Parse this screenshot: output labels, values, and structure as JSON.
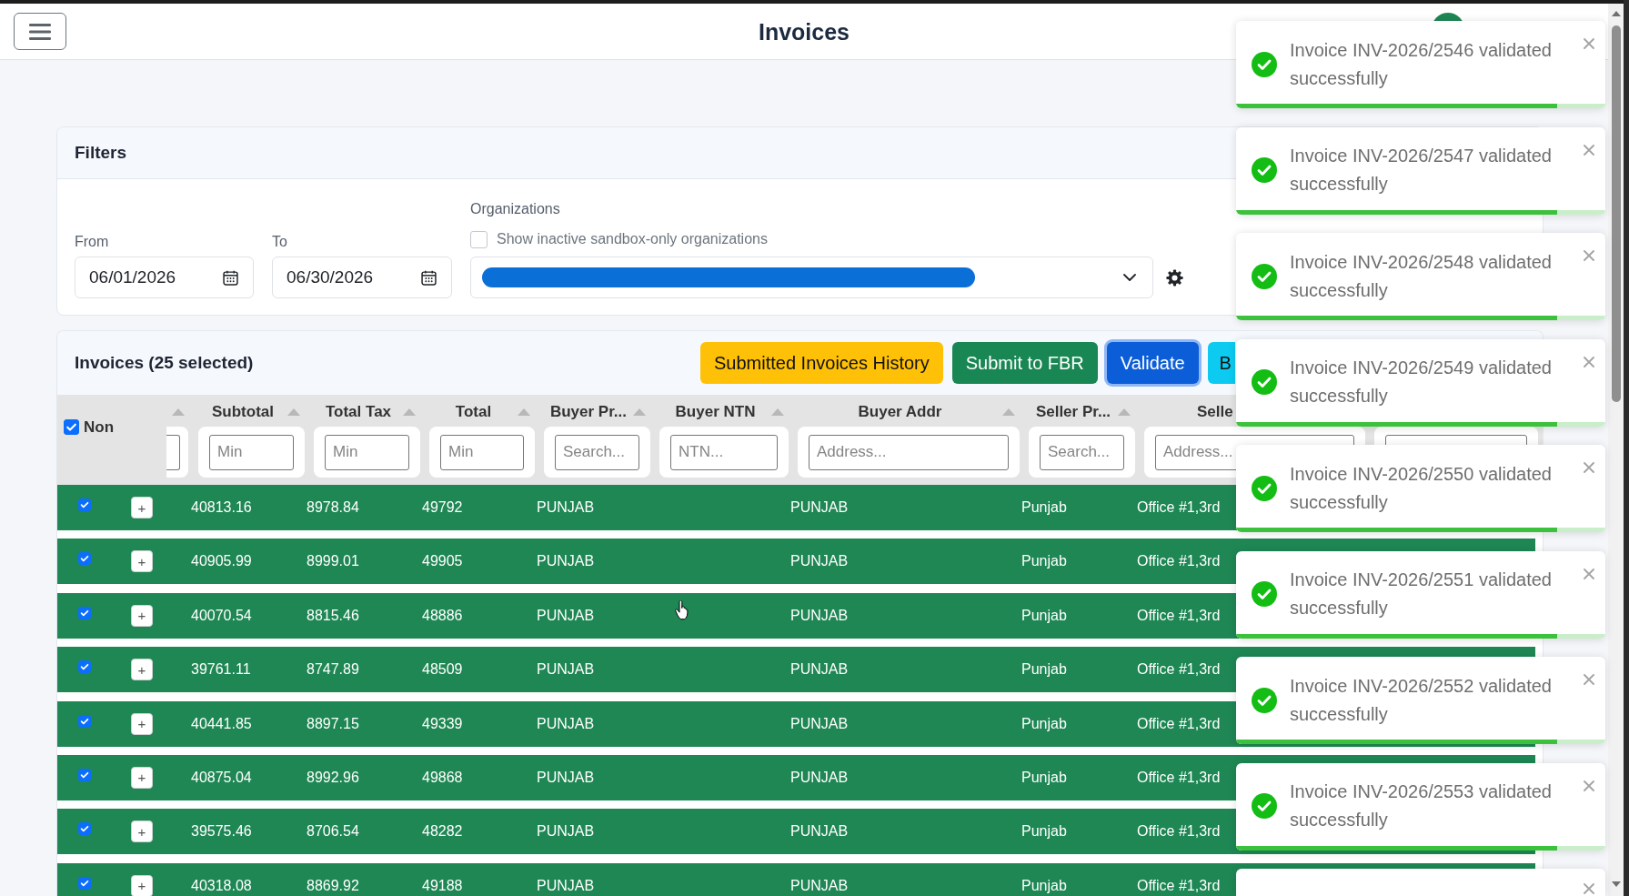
{
  "header": {
    "title": "Invoices"
  },
  "filters": {
    "title": "Filters",
    "from": {
      "label": "From",
      "value": "06/01/2026"
    },
    "to": {
      "label": "To",
      "value": "06/30/2026"
    },
    "organizations": {
      "label": "Organizations",
      "show_inactive": {
        "label": "Show inactive sandbox-only organizations",
        "checked": false
      },
      "select": {
        "redacted": true
      }
    }
  },
  "invoices": {
    "title": "Invoices (25 selected)",
    "buttons": [
      {
        "label": "Submitted Invoices History",
        "kind": "warning",
        "focused": false
      },
      {
        "label": "Submit to FBR",
        "kind": "success",
        "focused": false
      },
      {
        "label": "Validate",
        "kind": "primary",
        "focused": true
      },
      {
        "label": "B",
        "kind": "info",
        "focused": false
      }
    ],
    "table": {
      "select_all": {
        "label": "Non",
        "checked": true
      },
      "columns": [
        {
          "kind": "cut_left"
        },
        {
          "kind": "full",
          "title": "Subtotal",
          "placeholder": "Min"
        },
        {
          "kind": "full",
          "title": "Total Tax",
          "placeholder": "Min"
        },
        {
          "kind": "full",
          "title": "Total",
          "placeholder": "Min"
        },
        {
          "kind": "full",
          "title": "Buyer Pr...",
          "placeholder": "Search..."
        },
        {
          "kind": "full",
          "title": "Buyer NTN",
          "placeholder": "NTN..."
        },
        {
          "kind": "full",
          "title": "Buyer Addr",
          "placeholder": "Address..."
        },
        {
          "kind": "full",
          "title": "Seller Pr...",
          "placeholder": "Search..."
        },
        {
          "kind": "cut_right",
          "title": "Selle",
          "placeholder": "Address..."
        },
        {
          "kind": "filter_only"
        }
      ],
      "rows": [
        {
          "selected": true,
          "expand_button": "+",
          "subtotal": "40813.16",
          "total_tax": "8978.84",
          "total": "49792",
          "buyer_pr": "PUNJAB",
          "buyer_addr": "PUNJAB",
          "seller_pr": "Punjab",
          "seller_addr": "Office #1,3rd"
        },
        {
          "selected": true,
          "expand_button": "+",
          "subtotal": "40905.99",
          "total_tax": "8999.01",
          "total": "49905",
          "buyer_pr": "PUNJAB",
          "buyer_addr": "PUNJAB",
          "seller_pr": "Punjab",
          "seller_addr": "Office #1,3rd"
        },
        {
          "selected": true,
          "expand_button": "+",
          "subtotal": "40070.54",
          "total_tax": "8815.46",
          "total": "48886",
          "buyer_pr": "PUNJAB",
          "buyer_addr": "PUNJAB",
          "seller_pr": "Punjab",
          "seller_addr": "Office #1,3rd"
        },
        {
          "selected": true,
          "expand_button": "+",
          "subtotal": "39761.11",
          "total_tax": "8747.89",
          "total": "48509",
          "buyer_pr": "PUNJAB",
          "buyer_addr": "PUNJAB",
          "seller_pr": "Punjab",
          "seller_addr": "Office #1,3rd"
        },
        {
          "selected": true,
          "expand_button": "+",
          "subtotal": "40441.85",
          "total_tax": "8897.15",
          "total": "49339",
          "buyer_pr": "PUNJAB",
          "buyer_addr": "PUNJAB",
          "seller_pr": "Punjab",
          "seller_addr": "Office #1,3rd"
        },
        {
          "selected": true,
          "expand_button": "+",
          "subtotal": "40875.04",
          "total_tax": "8992.96",
          "total": "49868",
          "buyer_pr": "PUNJAB",
          "buyer_addr": "PUNJAB",
          "seller_pr": "Punjab",
          "seller_addr": "Office #1,3rd"
        },
        {
          "selected": true,
          "expand_button": "+",
          "subtotal": "39575.46",
          "total_tax": "8706.54",
          "total": "48282",
          "buyer_pr": "PUNJAB",
          "buyer_addr": "PUNJAB",
          "seller_pr": "Punjab",
          "seller_addr": "Office #1,3rd"
        },
        {
          "selected": true,
          "expand_button": "+",
          "subtotal": "40318.08",
          "total_tax": "8869.92",
          "total": "49188",
          "buyer_pr": "PUNJAB",
          "buyer_addr": "PUNJAB",
          "seller_pr": "Punjab",
          "seller_addr": "Office #1,3rd"
        }
      ]
    }
  },
  "toasts": [
    {
      "kind": "success",
      "message": "Invoice INV-2026/2546 validated successfully",
      "level": 0.87
    },
    {
      "kind": "success",
      "message": "Invoice INV-2026/2547 validated successfully",
      "level": 0.87
    },
    {
      "kind": "success",
      "message": "Invoice INV-2026/2548 validated successfully",
      "level": 0.87
    },
    {
      "kind": "success",
      "message": "Invoice INV-2026/2549 validated successfully",
      "level": 0.87
    },
    {
      "kind": "success",
      "message": "Invoice INV-2026/2550 validated successfully",
      "level": 0.87
    },
    {
      "kind": "success",
      "message": "Invoice INV-2026/2551 validated successfully",
      "level": 0.87
    },
    {
      "kind": "success",
      "message": "Invoice INV-2026/2552 validated successfully",
      "level": 0.87
    },
    {
      "kind": "success",
      "message": "Invoice INV-2026/2553 validated successfully",
      "level": 0.87
    },
    {
      "kind": "cut_off"
    }
  ]
}
